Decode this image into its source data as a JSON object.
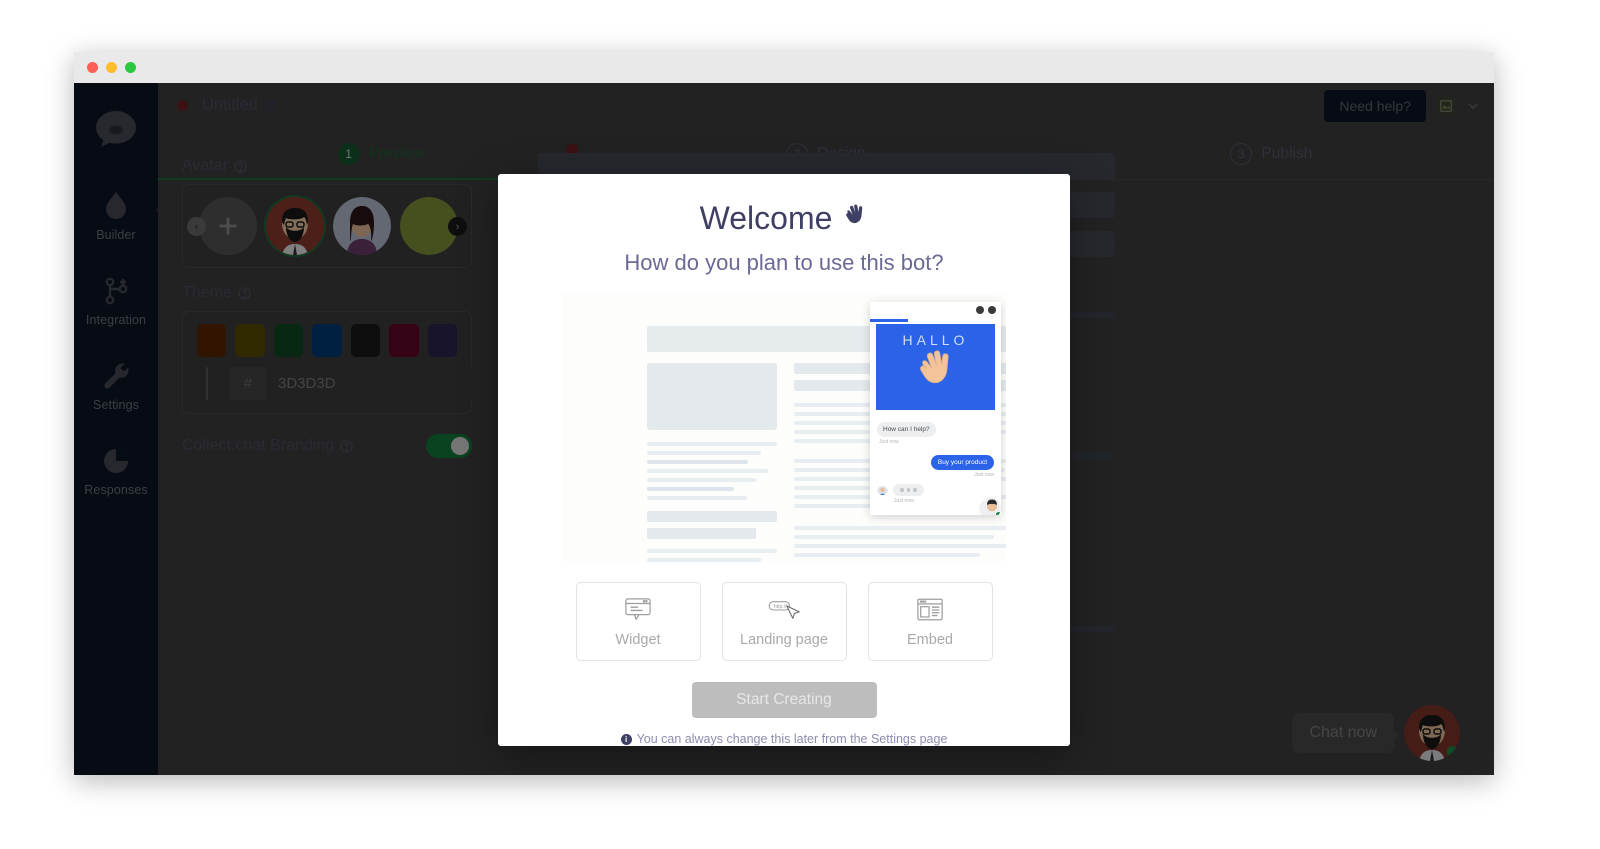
{
  "window": {
    "traffic_lights": [
      "close",
      "minimize",
      "zoom"
    ]
  },
  "sidebar": {
    "logo_icon": "chat-bubble-logo-icon",
    "items": [
      {
        "label": "Builder",
        "icon": "droplet-icon",
        "active": true
      },
      {
        "label": "Integration",
        "icon": "branch-plus-icon",
        "active": false
      },
      {
        "label": "Settings",
        "icon": "wrench-icon",
        "active": false
      },
      {
        "label": "Responses",
        "icon": "pie-chart-icon",
        "active": false
      }
    ]
  },
  "header": {
    "doc_title": "Untitled",
    "external_link_icon": "external-link-icon",
    "need_help_label": "Need help?",
    "avatar_icon": "broken-image-icon",
    "chevron_icon": "chevron-down-icon"
  },
  "steps": [
    {
      "num": "1",
      "label": "Preview",
      "state": "active"
    },
    {
      "num": "2",
      "label": "Design",
      "state": "idle"
    },
    {
      "num": "3",
      "label": "Publish",
      "state": "idle"
    }
  ],
  "panel": {
    "avatar": {
      "label": "Avatar",
      "help_icon": "question-circle-icon",
      "add_label": "+",
      "prev_icon": "chevron-left-icon",
      "next_icon": "chevron-right-icon"
    },
    "theme": {
      "label": "Theme",
      "help_icon": "question-circle-icon",
      "swatches": [
        "#5c2700",
        "#594b00",
        "#0f4a25",
        "#003b79",
        "#1a1a1a",
        "#64062a",
        "#2a2550",
        "#2e2820",
        "#3d3d3d",
        "#0d0d0d"
      ],
      "hash_symbol": "#",
      "hex_value": "3D3D3D",
      "hex_placeholder": "3D3D3D"
    },
    "branding": {
      "label": "Collect.chat Branding",
      "help_icon": "question-circle-icon",
      "enabled": true
    }
  },
  "chat_launcher": {
    "bubble_text": "Chat now",
    "avatar_icon": "bearded-man-avatar",
    "status": "online"
  },
  "modal": {
    "title": "Welcome",
    "wave_icon": "waving-hand-icon",
    "subtitle": "How do you plan to use this bot?",
    "preview": {
      "widget_headline": "HALLO",
      "hand_icon": "waving-hand-icon",
      "message_in": "How can I help?",
      "message_in_time": "Just now",
      "message_out": "Buy your product",
      "message_out_time": "Just now",
      "typing_time": "Just now",
      "close_icon": "close-icon",
      "minimize_icon": "minimize-icon"
    },
    "options": [
      {
        "label": "Widget",
        "icon": "chat-widget-icon",
        "selected": false
      },
      {
        "label": "Landing page",
        "icon": "url-bar-cursor-icon",
        "selected": false
      },
      {
        "label": "Embed",
        "icon": "embed-layout-icon",
        "selected": false
      }
    ],
    "primary_button": "Start Creating",
    "footer_icon": "info-icon",
    "footer_text": "You can always change this later from the Settings page"
  },
  "colors": {
    "accent_green": "#1e6e3c",
    "sidebar_bg": "#0d1426",
    "widget_blue": "#2b63e8",
    "modal_title": "#3f3f66"
  }
}
